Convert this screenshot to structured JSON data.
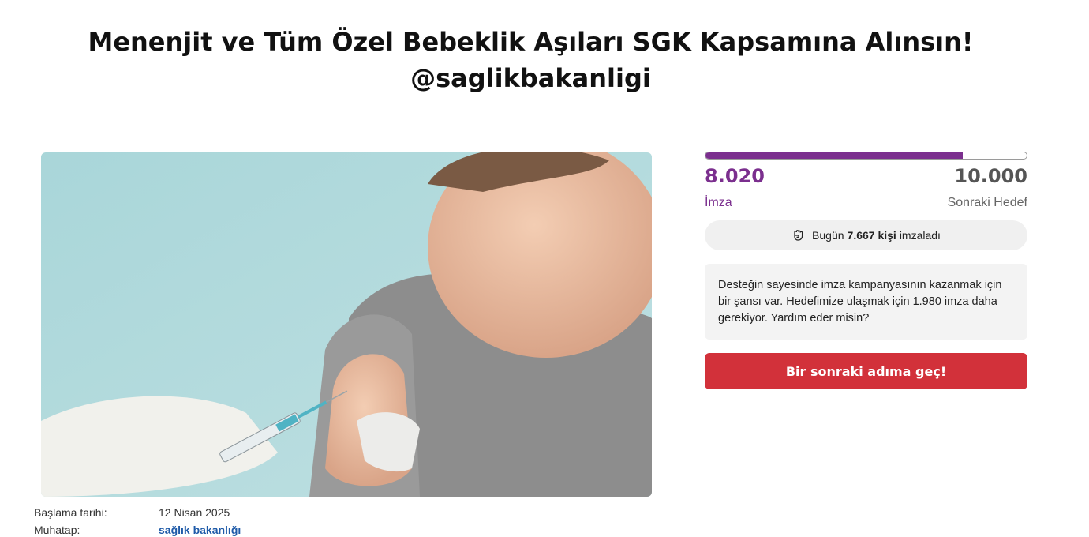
{
  "petition": {
    "title_line1": "Menenjit ve Tüm Özel Bebeklik Aşıları SGK Kapsamına Alınsın!",
    "title_line2": "@saglikbakanligi"
  },
  "meta": {
    "start_label": "Başlama tarihi:",
    "start_value": "12 Nisan 2025",
    "target_label": "Muhatap:",
    "target_value": "sağlık bakanlığı"
  },
  "progress": {
    "fraction": 0.802,
    "current": "8.020",
    "current_label": "İmza",
    "goal": "10.000",
    "goal_label": "Sonraki Hedef",
    "fill_color": "#7b2f8e"
  },
  "today": {
    "icon": "raised-fist-icon",
    "prefix": "Bugün",
    "count": "7.667 kişi",
    "suffix": "imzaladı"
  },
  "info": {
    "text": "Desteğin sayesinde imza kampanyasının kazanmak için bir şansı var. Hedefimize ulaşmak için 1.980 imza daha gerekiyor. Yardım eder misin?"
  },
  "cta": {
    "label": "Bir sonraki adıma geç!",
    "color": "#d2313a"
  }
}
